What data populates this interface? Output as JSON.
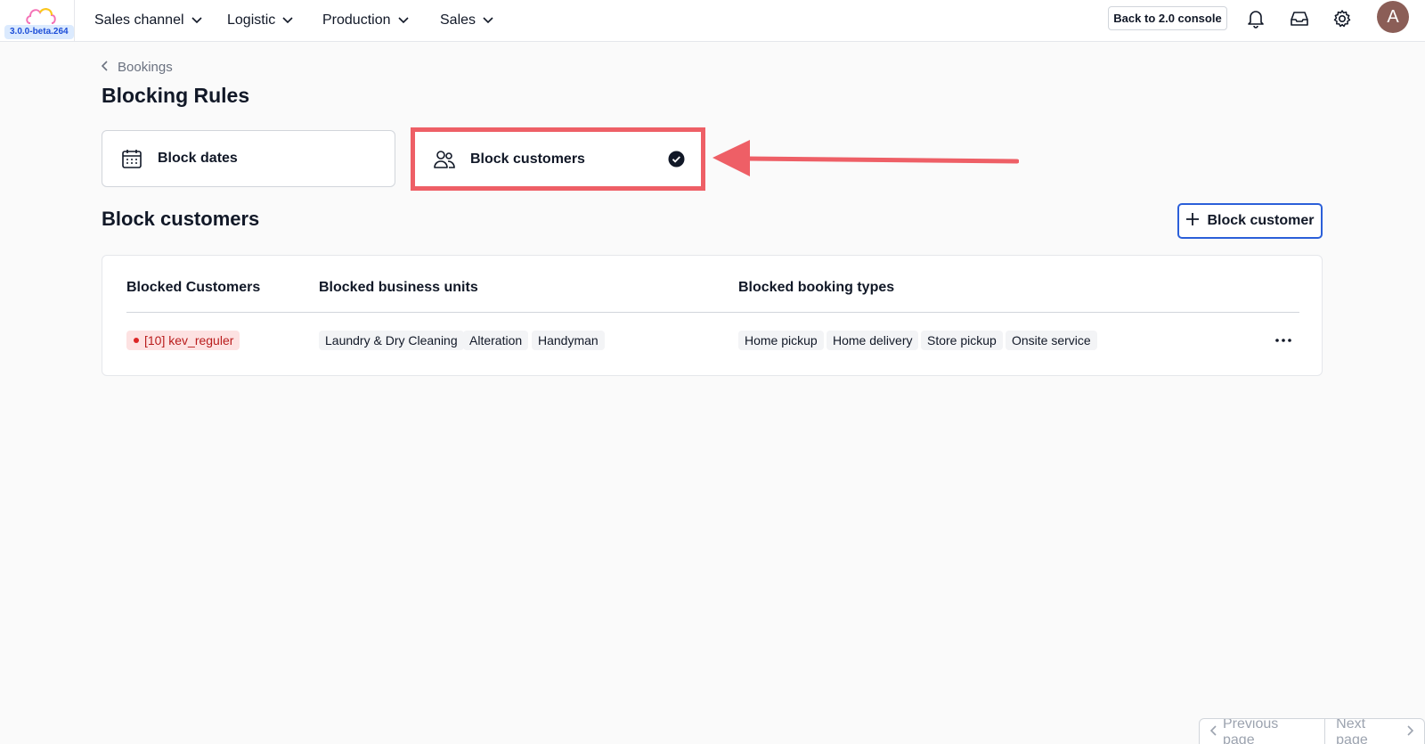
{
  "header": {
    "version": "3.0.0-beta.264",
    "nav": [
      {
        "label": "Sales channel"
      },
      {
        "label": "Logistic"
      },
      {
        "label": "Production"
      },
      {
        "label": "Sales"
      }
    ],
    "console_button": "Back to 2.0 console",
    "avatar_initial": "A",
    "icons": [
      "bell-icon",
      "inbox-icon",
      "gear-icon"
    ]
  },
  "breadcrumb": {
    "back": "Bookings"
  },
  "page_title": "Blocking Rules",
  "rule_types": [
    {
      "label": "Block dates",
      "icon": "calendar-icon",
      "selected": false
    },
    {
      "label": "Block customers",
      "icon": "users-icon",
      "selected": true
    }
  ],
  "section": {
    "title": "Block customers",
    "add_button": "Block customer"
  },
  "table": {
    "columns": [
      "Blocked Customers",
      "Blocked business units",
      "Blocked booking types"
    ],
    "rows": [
      {
        "customer": "[10] kev_reguler",
        "business_units": [
          "Laundry & Dry Cleaning",
          "Alteration",
          "Handyman"
        ],
        "booking_types": [
          "Home pickup",
          "Home delivery",
          "Store pickup",
          "Onsite service"
        ]
      }
    ]
  },
  "pagination": {
    "previous": "Previous page",
    "next": "Next page"
  },
  "colors": {
    "accent": "#2b5fd9",
    "highlight": "#ee5f66",
    "customer_chip": "#fde2e2"
  }
}
